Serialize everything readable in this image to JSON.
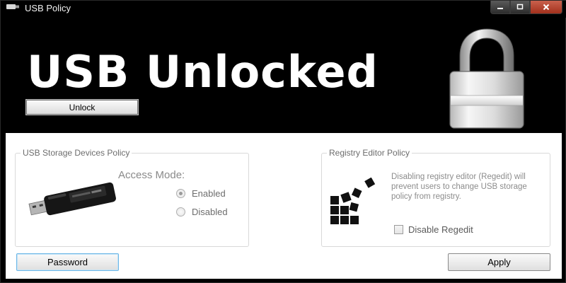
{
  "window": {
    "title": "USB Policy"
  },
  "header": {
    "status_title": "USB Unlocked",
    "unlock_button": "Unlock",
    "lock_icon": "padlock-open-icon"
  },
  "usb_policy": {
    "group_title": "USB Storage Devices Policy",
    "access_mode_label": "Access Mode:",
    "options": [
      {
        "label": "Enabled",
        "selected": true
      },
      {
        "label": "Disabled",
        "selected": false
      }
    ],
    "image": "usb-flash-drive-image"
  },
  "registry_policy": {
    "group_title": "Registry Editor Policy",
    "description": "Disabling registry editor (Regedit) will prevent users to change USB storage policy from registry.",
    "checkbox_label": "Disable Regedit",
    "checkbox_checked": false,
    "icon": "registry-editor-icon"
  },
  "footer": {
    "password_button": "Password",
    "apply_button": "Apply"
  },
  "colors": {
    "header_bg": "#000000",
    "body_bg": "#ffffff",
    "close_button": "#c0452f",
    "focus_border": "#6cb6e6"
  }
}
